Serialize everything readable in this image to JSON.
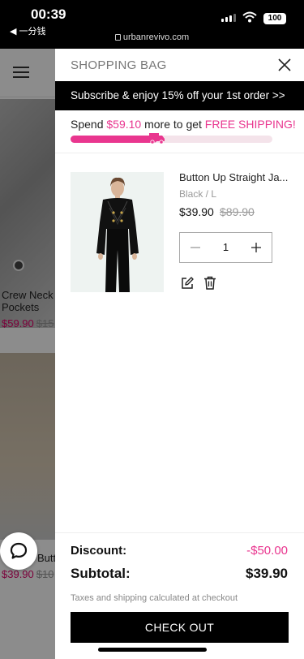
{
  "status_bar": {
    "time": "00:39",
    "back_app": "◀ 一分钱",
    "url": "urbanrevivo.com",
    "battery": "100"
  },
  "background_page": {
    "products": [
      {
        "title_line1": "Crew Neck",
        "title_line2": "Pockets",
        "price": "$59.90",
        "original_price": "$15"
      },
      {
        "title_line1": "Butt",
        "price": "$39.90",
        "original_price": "$10"
      }
    ]
  },
  "cart": {
    "title": "SHOPPING BAG",
    "promo": "Subscribe & enjoy 15% off your 1st order >>",
    "shipping": {
      "prefix": "Spend ",
      "amount": "$59.10",
      "middle": " more to get ",
      "highlight": "FREE SHIPPING!",
      "progress": 0.43
    },
    "item": {
      "name": "Button Up Straight Ja...",
      "variant": "Black / L",
      "price": "$39.90",
      "original_price": "$89.90",
      "quantity": "1"
    },
    "summary": {
      "discount_label": "Discount:",
      "discount_value": "-$50.00",
      "subtotal_label": "Subtotal:",
      "subtotal_value": "$39.90",
      "note": "Taxes and shipping calculated at checkout",
      "checkout_label": "CHECK OUT"
    }
  },
  "colors": {
    "accent_pink": "#e9368f",
    "promo_bg": "#000000",
    "progress_track": "#f4e3ea"
  },
  "icons": {
    "close": "close-icon",
    "edit": "edit-icon",
    "delete": "trash-icon",
    "chat": "chat-icon",
    "shipping": "truck-icon",
    "menu": "hamburger-menu-icon"
  }
}
